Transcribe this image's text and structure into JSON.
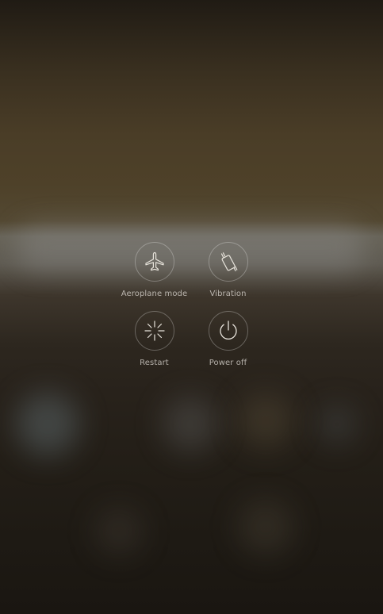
{
  "power_menu": {
    "items": [
      {
        "label": "Aeroplane mode",
        "icon": "airplane-icon"
      },
      {
        "label": "Vibration",
        "icon": "vibration-icon"
      },
      {
        "label": "Restart",
        "icon": "restart-icon"
      },
      {
        "label": "Power off",
        "icon": "power-icon"
      }
    ]
  },
  "colors": {
    "icon_stroke": "#e8e4dc",
    "label": "#bdb8b0",
    "ring": "#6e6a64"
  }
}
